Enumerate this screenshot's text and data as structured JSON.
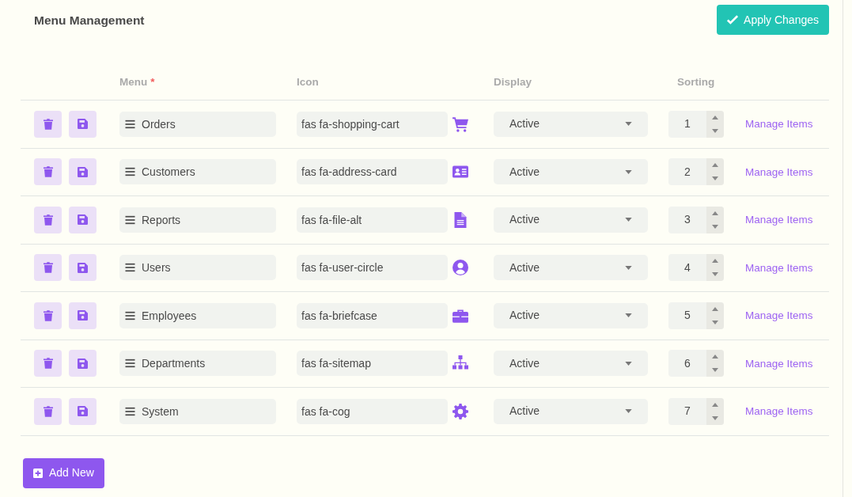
{
  "title": "Menu Management",
  "apply_button": "Apply Changes",
  "columns": {
    "menu": "Menu",
    "required_mark": "*",
    "icon": "Icon",
    "display": "Display",
    "sorting": "Sorting"
  },
  "rows": [
    {
      "menu": "Orders",
      "icon": "fas fa-shopping-cart",
      "kind": "cart",
      "display": "Active",
      "sorting": "1",
      "link": "Manage Items"
    },
    {
      "menu": "Customers",
      "icon": "fas fa-address-card",
      "kind": "card",
      "display": "Active",
      "sorting": "2",
      "link": "Manage Items"
    },
    {
      "menu": "Reports",
      "icon": "fas fa-file-alt",
      "kind": "file",
      "display": "Active",
      "sorting": "3",
      "link": "Manage Items"
    },
    {
      "menu": "Users",
      "icon": "fas fa-user-circle",
      "kind": "user",
      "display": "Active",
      "sorting": "4",
      "link": "Manage Items"
    },
    {
      "menu": "Employees",
      "icon": "fas fa-briefcase",
      "kind": "briefcase",
      "display": "Active",
      "sorting": "5",
      "link": "Manage Items"
    },
    {
      "menu": "Departments",
      "icon": "fas fa-sitemap",
      "kind": "sitemap",
      "display": "Active",
      "sorting": "6",
      "link": "Manage Items"
    },
    {
      "menu": "System",
      "icon": "fas fa-cog",
      "kind": "cog",
      "display": "Active",
      "sorting": "7",
      "link": "Manage Items"
    }
  ],
  "add_button": "Add New"
}
